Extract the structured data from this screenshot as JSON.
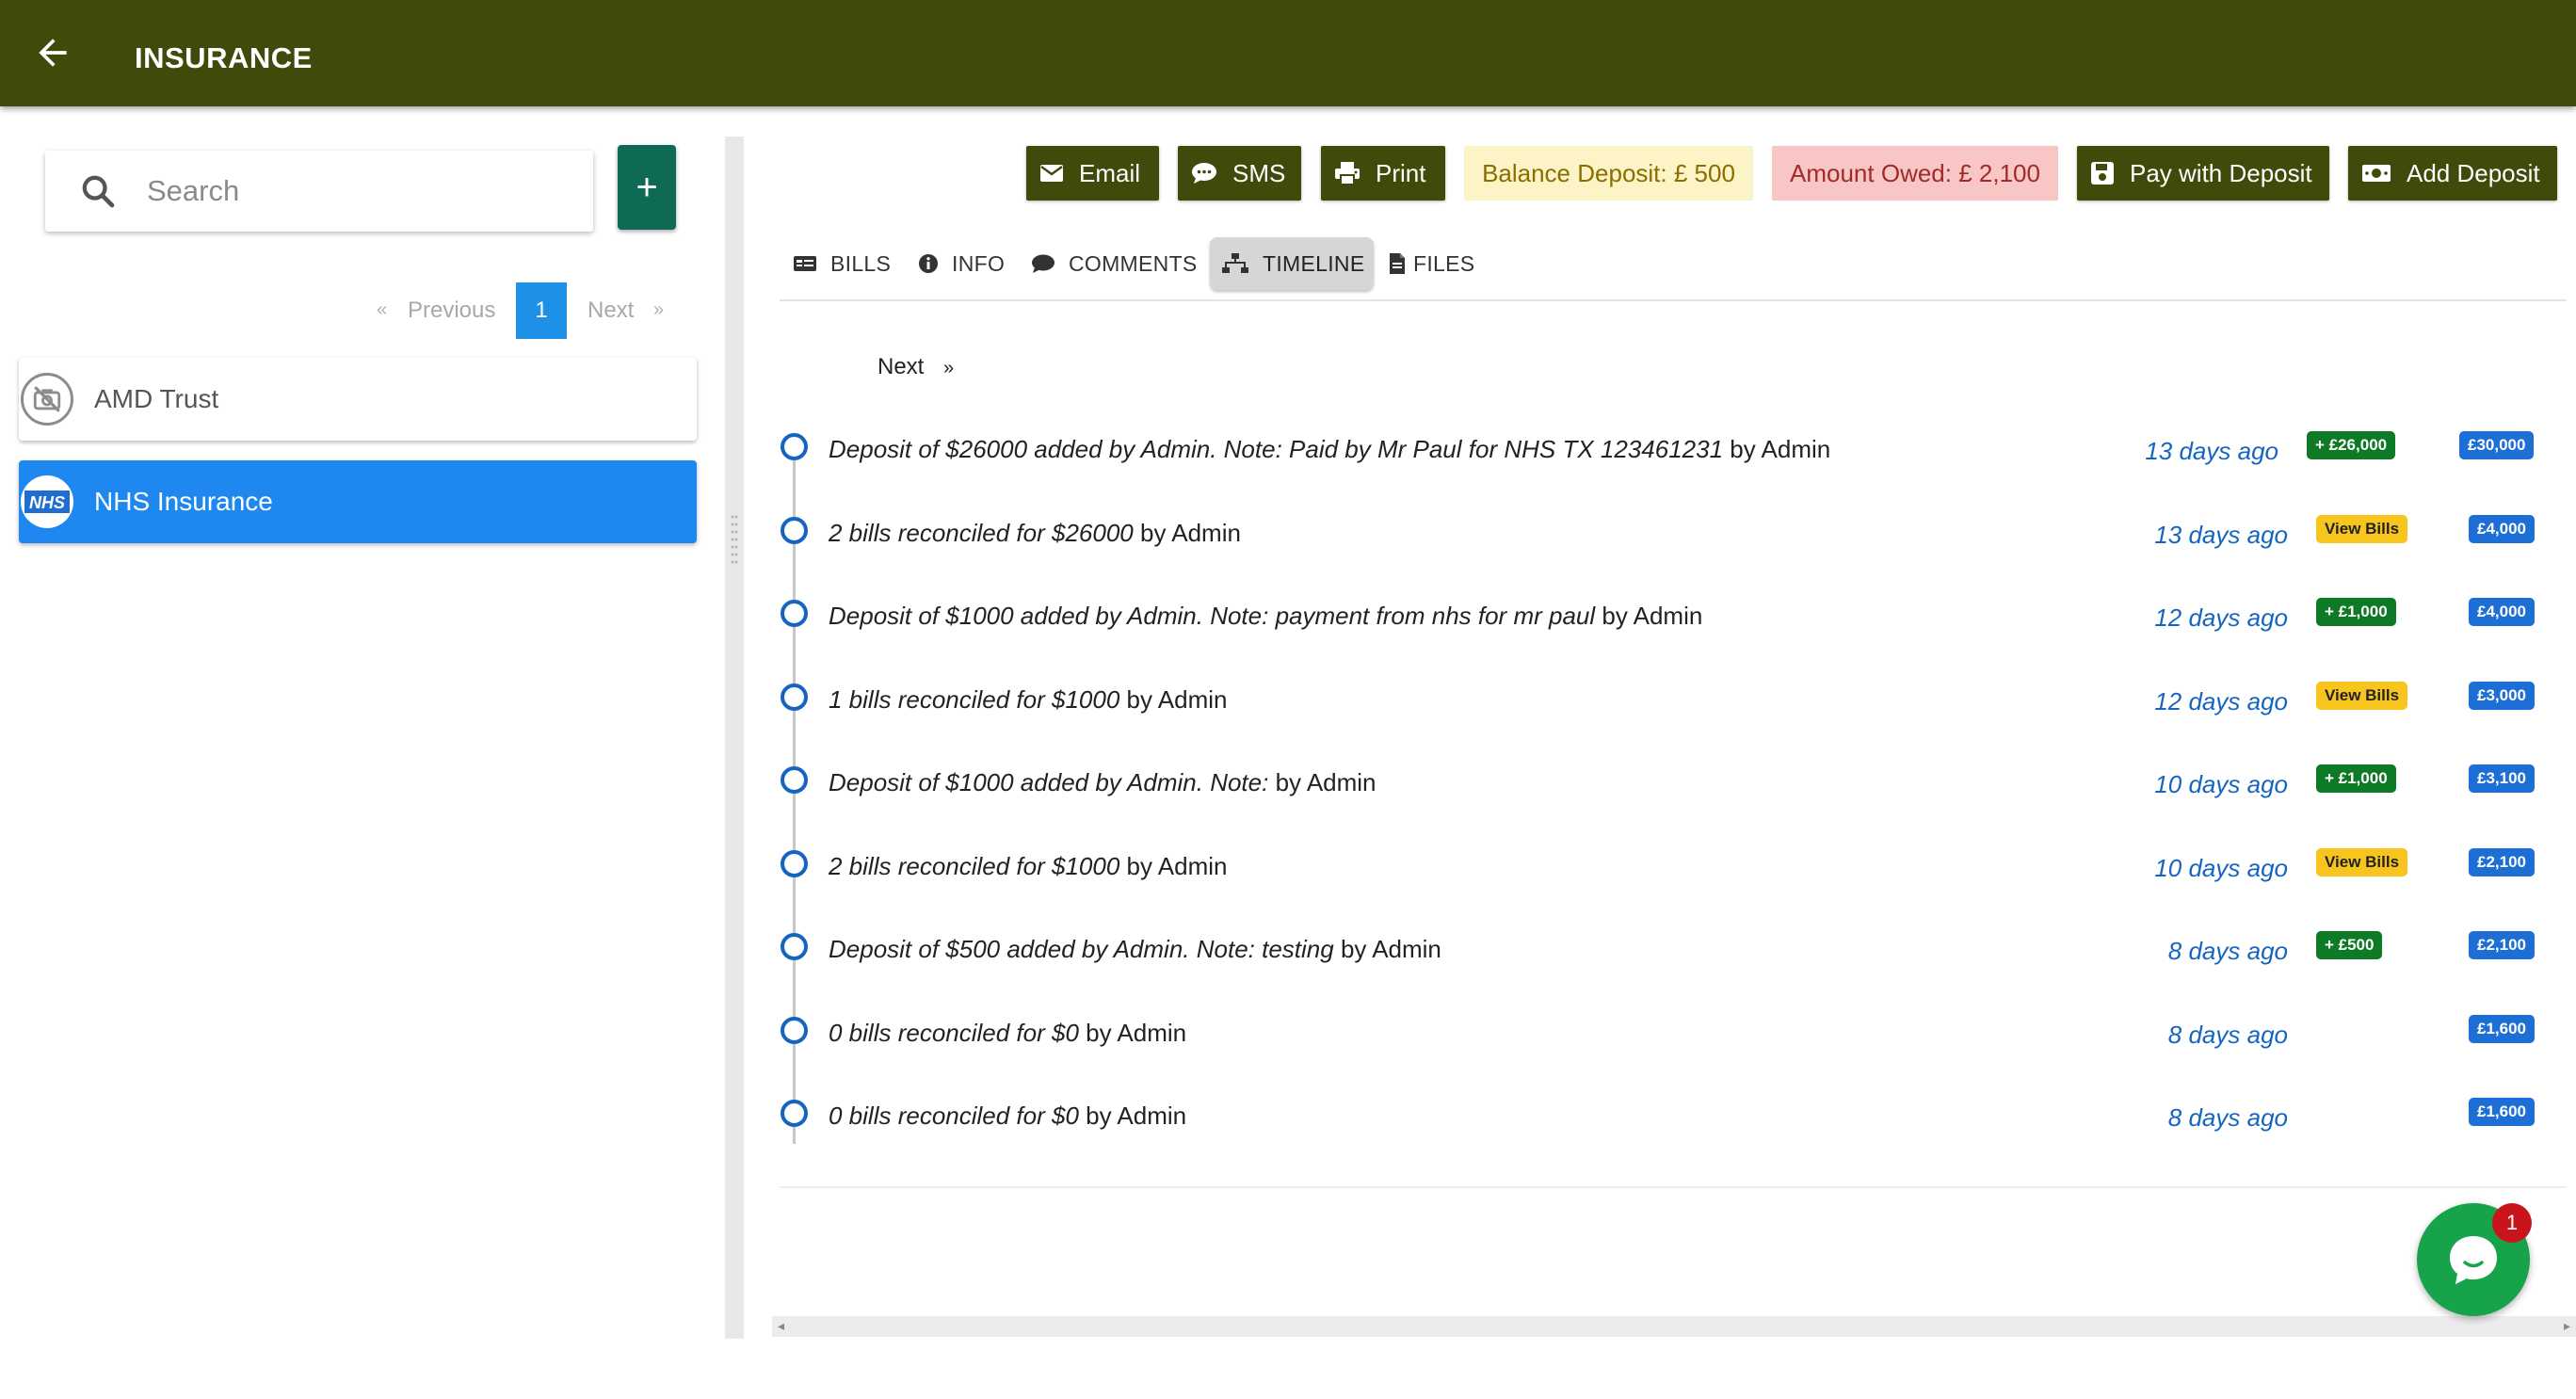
{
  "header": {
    "title": "INSURANCE",
    "back_icon": "arrow-left-icon",
    "color": "#3f4a0b"
  },
  "sidebar": {
    "search": {
      "placeholder": "Search",
      "value": ""
    },
    "add_label": "+",
    "pagination": {
      "prev": "Previous",
      "page": "1",
      "next": "Next",
      "prev_arrow": "«",
      "next_arrow": "»"
    },
    "accounts": [
      {
        "name": "AMD Trust",
        "icon": "no-photo-icon",
        "selected": false
      },
      {
        "name": "NHS Insurance",
        "icon": "nhs-logo",
        "logo_text": "NHS",
        "selected": true
      }
    ]
  },
  "toolbar": {
    "email": "Email",
    "sms": "SMS",
    "print": "Print",
    "balance_deposit": "Balance Deposit: £ 500",
    "amount_owed": "Amount Owed: £ 2,100",
    "pay_with_deposit": "Pay with Deposit",
    "add_deposit": "Add Deposit"
  },
  "tabs": [
    {
      "label": "BILLS",
      "icon": "bills-icon"
    },
    {
      "label": "INFO",
      "icon": "info-icon"
    },
    {
      "label": "COMMENTS",
      "icon": "comment-icon"
    },
    {
      "label": "TIMELINE",
      "icon": "sitemap-icon",
      "active": true
    },
    {
      "label": "FILES",
      "icon": "file-icon"
    }
  ],
  "timeline": {
    "next_label": "Next",
    "next_arrow": "»",
    "items": [
      {
        "text": "Deposit of $26000 added by Admin. Note: Paid by Mr Paul for NHS TX 123461231",
        "by": " by Admin",
        "time": "13 days ago",
        "badge": "+ £26,000",
        "badge_type": "green",
        "balance": "£30,000"
      },
      {
        "text": "2 bills reconciled for $26000",
        "by": " by Admin",
        "time": "13 days ago",
        "badge": "View Bills",
        "badge_type": "yellow",
        "balance": "£4,000"
      },
      {
        "text": "Deposit of $1000 added by Admin. Note: payment from nhs for mr paul",
        "by": " by Admin",
        "time": "12 days ago",
        "badge": "+ £1,000",
        "badge_type": "green",
        "balance": "£4,000"
      },
      {
        "text": "1 bills reconciled for $1000",
        "by": " by Admin",
        "time": "12 days ago",
        "badge": "View Bills",
        "badge_type": "yellow",
        "balance": "£3,000"
      },
      {
        "text": "Deposit of $1000 added by Admin. Note:",
        "by": " by Admin",
        "time": "10 days ago",
        "badge": "+ £1,000",
        "badge_type": "green",
        "balance": "£3,100"
      },
      {
        "text": "2 bills reconciled for $1000",
        "by": " by Admin",
        "time": "10 days ago",
        "badge": "View Bills",
        "badge_type": "yellow",
        "balance": "£2,100"
      },
      {
        "text": "Deposit of $500 added by Admin. Note: testing",
        "by": " by Admin",
        "time": "8 days ago",
        "badge": "+ £500",
        "badge_type": "green",
        "balance": "£2,100"
      },
      {
        "text": "0 bills reconciled for $0",
        "by": " by Admin",
        "time": "8 days ago",
        "badge": "",
        "badge_type": "",
        "balance": "£1,600"
      },
      {
        "text": "0 bills reconciled for $0",
        "by": " by Admin",
        "time": "8 days ago",
        "badge": "",
        "badge_type": "",
        "balance": "£1,600"
      }
    ]
  },
  "chat": {
    "icon": "chat-bubble-icon",
    "unread_count": "1"
  }
}
